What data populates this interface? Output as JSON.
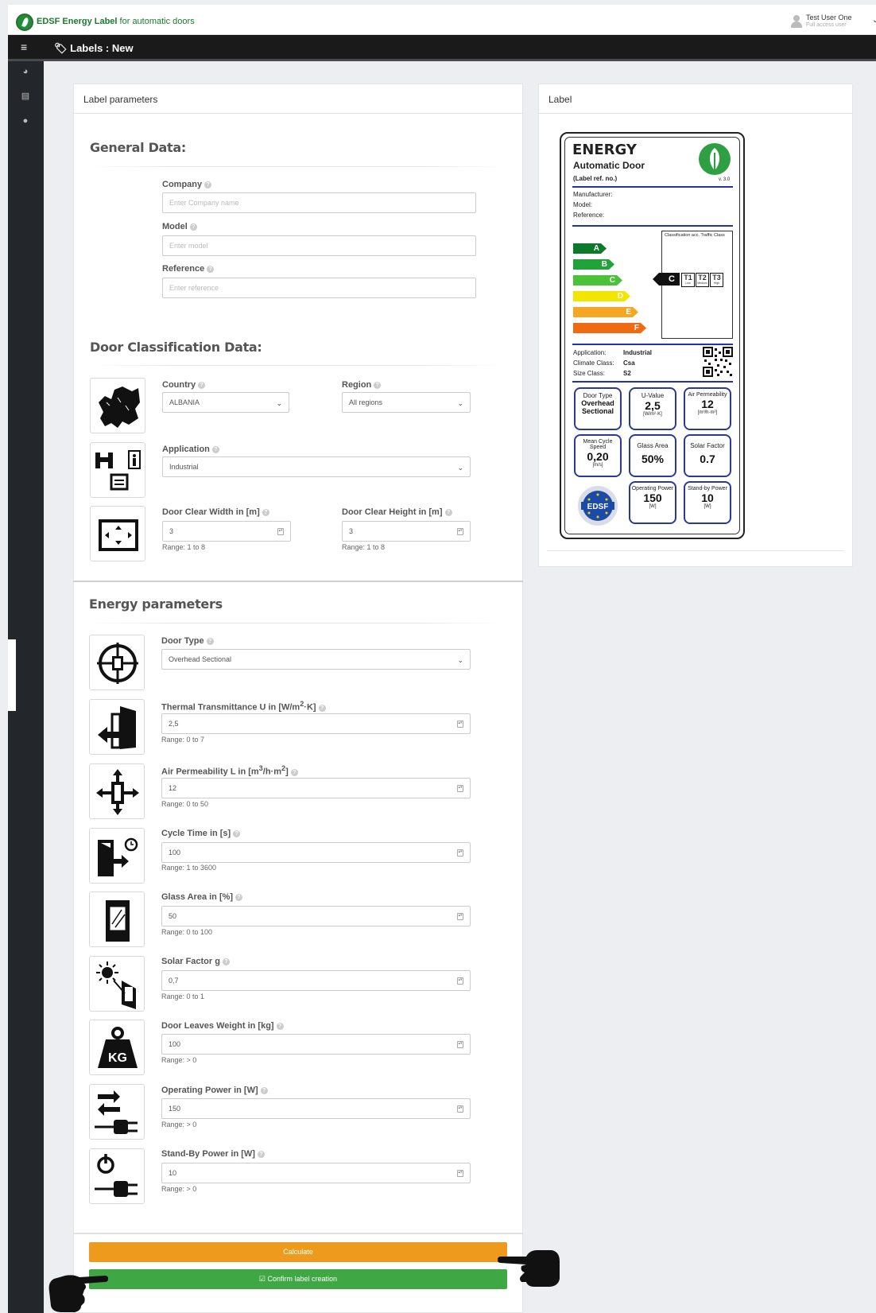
{
  "header": {
    "brand_bold": "EDSF Energy Label",
    "brand_rest": "for automatic doors",
    "user_name": "Test User One",
    "user_role": "Full access user"
  },
  "titlebar": {
    "title": "Labels : New"
  },
  "sidebar": {
    "items": [
      "dashboard-icon",
      "document-icon",
      "user-icon"
    ]
  },
  "params_panel": {
    "heading": "Label parameters"
  },
  "label_panel": {
    "heading": "Label"
  },
  "general": {
    "title": "General Data:",
    "company": {
      "label": "Company",
      "placeholder": "Enter Company name"
    },
    "model": {
      "label": "Model",
      "placeholder": "Enter model"
    },
    "reference": {
      "label": "Reference",
      "placeholder": "Enter reference"
    }
  },
  "classification": {
    "title": "Door Classification Data:",
    "country": {
      "label": "Country",
      "value": "ALBANIA"
    },
    "region": {
      "label": "Region",
      "value": "All regions"
    },
    "application": {
      "label": "Application",
      "value": "Industrial"
    },
    "width": {
      "label": "Door Clear Width in [m]",
      "value": "3",
      "range": "Range: 1 to 8"
    },
    "height": {
      "label": "Door Clear Height in [m]",
      "value": "3",
      "range": "Range: 1 to 8"
    }
  },
  "energy": {
    "title": "Energy parameters",
    "door_type": {
      "label": "Door Type",
      "value": "Overhead Sectional"
    },
    "thermal": {
      "label_a": "Thermal Transmittance U in [W/m",
      "sup": "2",
      "label_b": "·K]",
      "value": "2,5",
      "range": "Range: 0 to 7"
    },
    "air": {
      "label_a": "Air Permeability L in [m",
      "sup": "3",
      "label_b": "/h·m",
      "sup2": "2",
      "label_c": "]",
      "value": "12",
      "range": "Range: 0 to 50"
    },
    "cycle": {
      "label": "Cycle Time in [s]",
      "value": "100",
      "range": "Range: 1 to 3600"
    },
    "glass": {
      "label": "Glass Area in [%]",
      "value": "50",
      "range": "Range: 0 to 100"
    },
    "solar": {
      "label": "Solar Factor g",
      "value": "0,7",
      "range": "Range: 0 to 1"
    },
    "weight": {
      "label": "Door Leaves Weight in [kg]",
      "value": "100",
      "range": "Range: > 0"
    },
    "operating": {
      "label": "Operating Power in [W]",
      "value": "150",
      "range": "Range: > 0"
    },
    "standby": {
      "label": "Stand-By Power in [W]",
      "value": "10",
      "range": "Range: > 0"
    }
  },
  "buttons": {
    "calculate": "Calculate",
    "confirm": "Confirm label creation"
  },
  "energy_label": {
    "title": "ENERGY",
    "subtitle": "Automatic Door",
    "ref": "(Label ref. no.)",
    "version": "v. 3.0",
    "manufacturer": "Manufacturer:",
    "model": "Model:",
    "reference": "Reference:",
    "class_heading": "Classification acc. Traffic Class",
    "classes": [
      "A",
      "B",
      "C",
      "D",
      "E",
      "F"
    ],
    "class_colors": [
      "#0b7a2a",
      "#21a33a",
      "#4cc238",
      "#f2e500",
      "#f5a623",
      "#ee6a13"
    ],
    "current_class": "C",
    "traffic": [
      "T1",
      "T2",
      "T3"
    ],
    "traffic_sub": [
      "Low",
      "Medium",
      "High"
    ],
    "application_k": "Application:",
    "application_v": "Industrial",
    "climate_k": "Climate Class:",
    "climate_v": "Csa",
    "size_k": "Size Class:",
    "size_v": "S2",
    "tiles": {
      "door_type": {
        "t": "Door Type",
        "v": "Overhead Sectional"
      },
      "u_value": {
        "t": "U-Value",
        "v": "2,5",
        "u": "[W/m²·K]"
      },
      "air": {
        "t": "Air Permeability",
        "v": "12",
        "u": "[m³/h·m²]"
      },
      "cycle": {
        "t": "Mean Cycle Speed",
        "v": "0,20",
        "u": "[m/s]"
      },
      "glass": {
        "t": "Glass Area",
        "v": "50%"
      },
      "solar": {
        "t": "Solar Factor",
        "v": "0.7"
      },
      "operating": {
        "t": "Operating Power",
        "v": "150",
        "u": "[W]"
      },
      "standby": {
        "t": "Stand-by Power",
        "v": "10",
        "u": "[W]"
      }
    },
    "seal_text": "EDSF"
  }
}
